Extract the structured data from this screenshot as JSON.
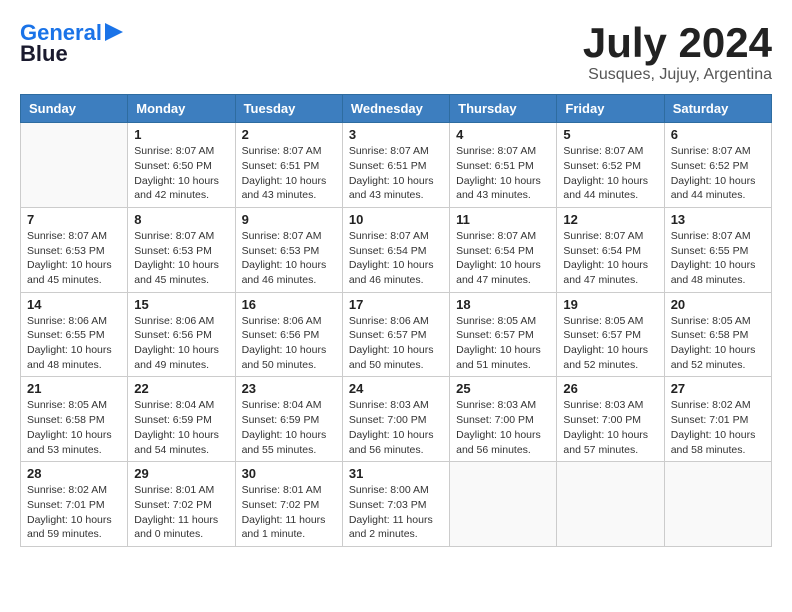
{
  "header": {
    "logo_line1": "General",
    "logo_line2": "Blue",
    "month": "July 2024",
    "location": "Susques, Jujuy, Argentina"
  },
  "weekdays": [
    "Sunday",
    "Monday",
    "Tuesday",
    "Wednesday",
    "Thursday",
    "Friday",
    "Saturday"
  ],
  "weeks": [
    [
      {
        "day": "",
        "info": ""
      },
      {
        "day": "1",
        "info": "Sunrise: 8:07 AM\nSunset: 6:50 PM\nDaylight: 10 hours\nand 42 minutes."
      },
      {
        "day": "2",
        "info": "Sunrise: 8:07 AM\nSunset: 6:51 PM\nDaylight: 10 hours\nand 43 minutes."
      },
      {
        "day": "3",
        "info": "Sunrise: 8:07 AM\nSunset: 6:51 PM\nDaylight: 10 hours\nand 43 minutes."
      },
      {
        "day": "4",
        "info": "Sunrise: 8:07 AM\nSunset: 6:51 PM\nDaylight: 10 hours\nand 43 minutes."
      },
      {
        "day": "5",
        "info": "Sunrise: 8:07 AM\nSunset: 6:52 PM\nDaylight: 10 hours\nand 44 minutes."
      },
      {
        "day": "6",
        "info": "Sunrise: 8:07 AM\nSunset: 6:52 PM\nDaylight: 10 hours\nand 44 minutes."
      }
    ],
    [
      {
        "day": "7",
        "info": "Sunrise: 8:07 AM\nSunset: 6:53 PM\nDaylight: 10 hours\nand 45 minutes."
      },
      {
        "day": "8",
        "info": "Sunrise: 8:07 AM\nSunset: 6:53 PM\nDaylight: 10 hours\nand 45 minutes."
      },
      {
        "day": "9",
        "info": "Sunrise: 8:07 AM\nSunset: 6:53 PM\nDaylight: 10 hours\nand 46 minutes."
      },
      {
        "day": "10",
        "info": "Sunrise: 8:07 AM\nSunset: 6:54 PM\nDaylight: 10 hours\nand 46 minutes."
      },
      {
        "day": "11",
        "info": "Sunrise: 8:07 AM\nSunset: 6:54 PM\nDaylight: 10 hours\nand 47 minutes."
      },
      {
        "day": "12",
        "info": "Sunrise: 8:07 AM\nSunset: 6:54 PM\nDaylight: 10 hours\nand 47 minutes."
      },
      {
        "day": "13",
        "info": "Sunrise: 8:07 AM\nSunset: 6:55 PM\nDaylight: 10 hours\nand 48 minutes."
      }
    ],
    [
      {
        "day": "14",
        "info": "Sunrise: 8:06 AM\nSunset: 6:55 PM\nDaylight: 10 hours\nand 48 minutes."
      },
      {
        "day": "15",
        "info": "Sunrise: 8:06 AM\nSunset: 6:56 PM\nDaylight: 10 hours\nand 49 minutes."
      },
      {
        "day": "16",
        "info": "Sunrise: 8:06 AM\nSunset: 6:56 PM\nDaylight: 10 hours\nand 50 minutes."
      },
      {
        "day": "17",
        "info": "Sunrise: 8:06 AM\nSunset: 6:57 PM\nDaylight: 10 hours\nand 50 minutes."
      },
      {
        "day": "18",
        "info": "Sunrise: 8:05 AM\nSunset: 6:57 PM\nDaylight: 10 hours\nand 51 minutes."
      },
      {
        "day": "19",
        "info": "Sunrise: 8:05 AM\nSunset: 6:57 PM\nDaylight: 10 hours\nand 52 minutes."
      },
      {
        "day": "20",
        "info": "Sunrise: 8:05 AM\nSunset: 6:58 PM\nDaylight: 10 hours\nand 52 minutes."
      }
    ],
    [
      {
        "day": "21",
        "info": "Sunrise: 8:05 AM\nSunset: 6:58 PM\nDaylight: 10 hours\nand 53 minutes."
      },
      {
        "day": "22",
        "info": "Sunrise: 8:04 AM\nSunset: 6:59 PM\nDaylight: 10 hours\nand 54 minutes."
      },
      {
        "day": "23",
        "info": "Sunrise: 8:04 AM\nSunset: 6:59 PM\nDaylight: 10 hours\nand 55 minutes."
      },
      {
        "day": "24",
        "info": "Sunrise: 8:03 AM\nSunset: 7:00 PM\nDaylight: 10 hours\nand 56 minutes."
      },
      {
        "day": "25",
        "info": "Sunrise: 8:03 AM\nSunset: 7:00 PM\nDaylight: 10 hours\nand 56 minutes."
      },
      {
        "day": "26",
        "info": "Sunrise: 8:03 AM\nSunset: 7:00 PM\nDaylight: 10 hours\nand 57 minutes."
      },
      {
        "day": "27",
        "info": "Sunrise: 8:02 AM\nSunset: 7:01 PM\nDaylight: 10 hours\nand 58 minutes."
      }
    ],
    [
      {
        "day": "28",
        "info": "Sunrise: 8:02 AM\nSunset: 7:01 PM\nDaylight: 10 hours\nand 59 minutes."
      },
      {
        "day": "29",
        "info": "Sunrise: 8:01 AM\nSunset: 7:02 PM\nDaylight: 11 hours\nand 0 minutes."
      },
      {
        "day": "30",
        "info": "Sunrise: 8:01 AM\nSunset: 7:02 PM\nDaylight: 11 hours\nand 1 minute."
      },
      {
        "day": "31",
        "info": "Sunrise: 8:00 AM\nSunset: 7:03 PM\nDaylight: 11 hours\nand 2 minutes."
      },
      {
        "day": "",
        "info": ""
      },
      {
        "day": "",
        "info": ""
      },
      {
        "day": "",
        "info": ""
      }
    ]
  ]
}
